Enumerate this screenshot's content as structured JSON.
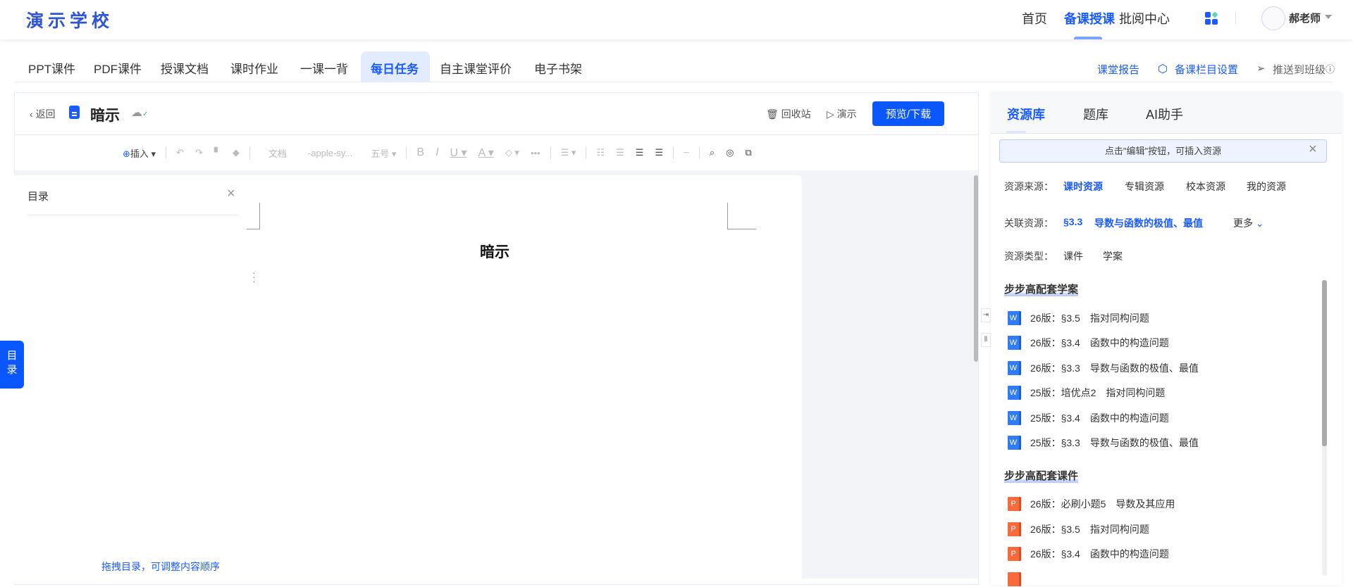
{
  "header": {
    "logo": "演示学校",
    "nav": [
      "首页",
      "备课授课",
      "批阅中心"
    ],
    "active_nav": "备课授课",
    "user": "郝老师"
  },
  "tabs": [
    "PPT课件",
    "PDF课件",
    "授课文档",
    "课时作业",
    "一课一背",
    "每日任务",
    "自主课堂评价",
    "电子书架"
  ],
  "active_tab": "每日任务",
  "right_links": {
    "report": "课堂报告",
    "settings": "备课栏目设置",
    "push": "推送到班级"
  },
  "editor": {
    "back": "返回",
    "title": "暗示",
    "recycle": "回收站",
    "present": "演示",
    "preview": "预览/下载",
    "toolbar": {
      "insert": "插入",
      "style": "文档",
      "font": "-apple-sy...",
      "size": "五号"
    },
    "page_title": "暗示"
  },
  "toc": {
    "title": "目录",
    "hint": "拖拽目录，可调整内容顺序",
    "side_tab": "目录"
  },
  "panel": {
    "tabs": [
      "资源库",
      "题库",
      "AI助手"
    ],
    "banner": "点击\"编辑\"按钮，可插入资源",
    "source_label": "资源来源：",
    "sources": [
      "课时资源",
      "专辑资源",
      "校本资源",
      "我的资源"
    ],
    "related_label": "关联资源：",
    "related_section": "§3.3",
    "related_title": "导数与函数的极值、最值",
    "more": "更多",
    "type_label": "资源类型：",
    "types": [
      "课件",
      "学案"
    ],
    "sections": [
      {
        "title": "步步高配套学案",
        "type": "w",
        "items": [
          "26版：§3.5　指对同构问题",
          "26版：§3.4　函数中的构造问题",
          "26版：§3.3　导数与函数的极值、最值",
          "25版：培优点2　指对同构问题",
          "25版：§3.4　函数中的构造问题",
          "25版：§3.3　导数与函数的极值、最值"
        ]
      },
      {
        "title": "步步高配套课件",
        "type": "p",
        "items": [
          "26版：必刷小题5　导数及其应用",
          "26版：§3.5　指对同构问题",
          "26版：§3.4　函数中的构造问题"
        ]
      }
    ]
  },
  "colors": {
    "accent": "#0a57ff",
    "logo": "#2e55d6"
  }
}
